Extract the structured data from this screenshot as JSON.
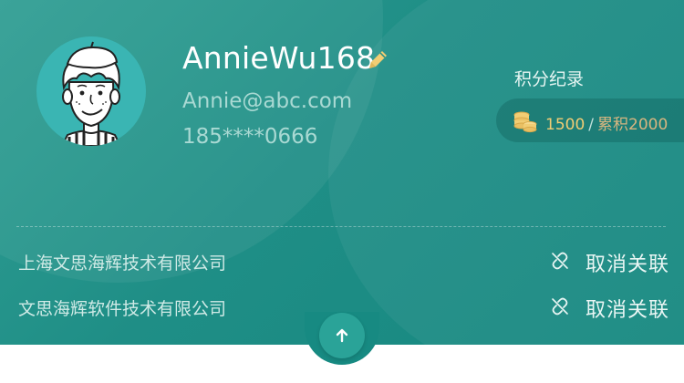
{
  "profile": {
    "username": "AnnieWu168",
    "email": "Annie@abc.com",
    "phone": "185****0666"
  },
  "points": {
    "title": "积分纪录",
    "current": "1500",
    "separator": "/",
    "total": "累积2000"
  },
  "companies": [
    {
      "name": "上海文思海辉技术有限公司",
      "action_label": "取消关联"
    },
    {
      "name": "文思海辉软件技术有限公司",
      "action_label": "取消关联"
    }
  ],
  "icons": {
    "edit": "pencil-icon",
    "points": "coins-icon",
    "unlink": "broken-link-icon",
    "collapse": "arrow-up-icon"
  },
  "colors": {
    "card_background": "#1f8e86",
    "accent_gold": "#f1cd74",
    "muted_text": "#a9d9d3"
  }
}
